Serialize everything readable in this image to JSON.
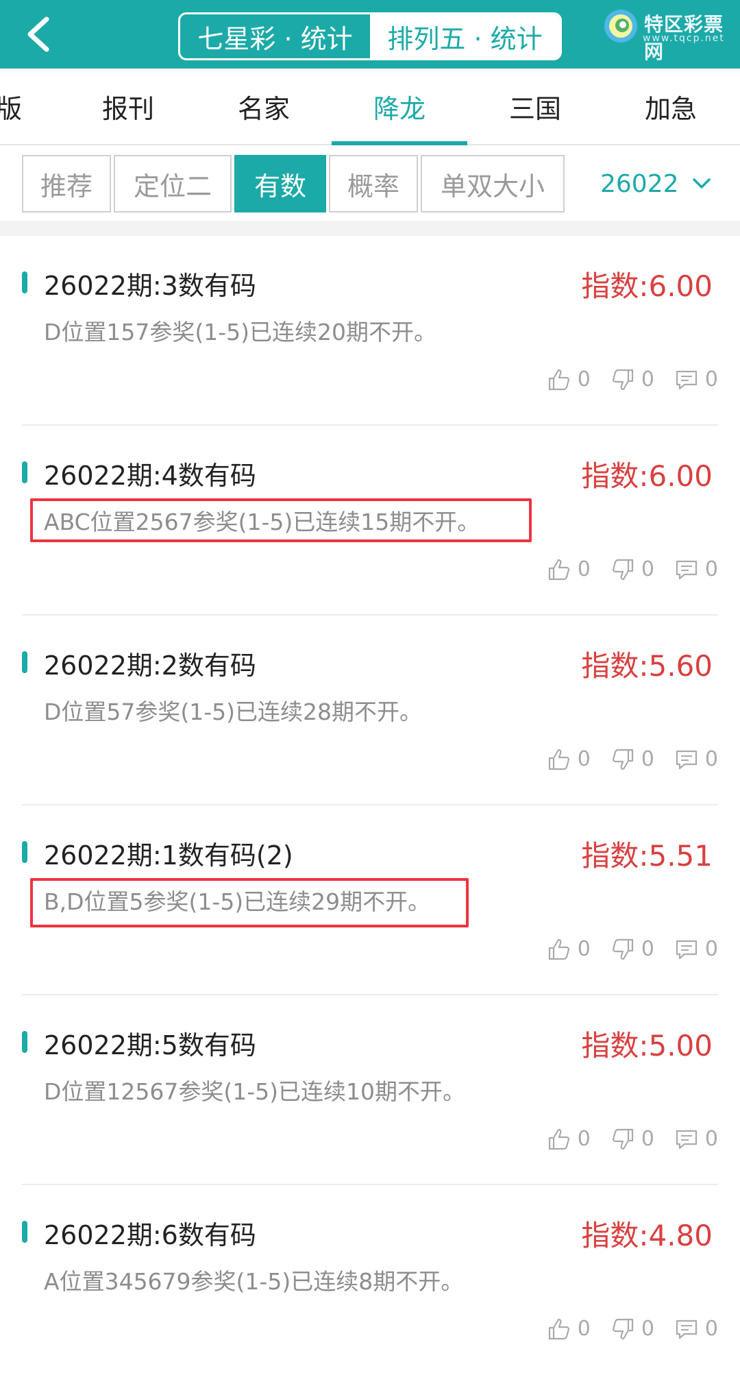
{
  "header": {
    "segments": [
      {
        "label": "七星彩 · 统计",
        "active": false
      },
      {
        "label": "排列五 · 统计",
        "active": true
      }
    ],
    "logo": {
      "text": "特区彩票网",
      "sub": "www.tqcp.net"
    }
  },
  "tabs": [
    {
      "label": "版",
      "active": false
    },
    {
      "label": "报刊",
      "active": false
    },
    {
      "label": "名家",
      "active": false
    },
    {
      "label": "降龙",
      "active": true
    },
    {
      "label": "三国",
      "active": false
    },
    {
      "label": "加急",
      "active": false
    }
  ],
  "filters": [
    {
      "label": "推荐",
      "active": false
    },
    {
      "label": "定位二",
      "active": false
    },
    {
      "label": "有数",
      "active": true
    },
    {
      "label": "概率",
      "active": false
    },
    {
      "label": "单双大小",
      "active": false
    }
  ],
  "period": "26022",
  "colors": {
    "accent": "#1caaa8",
    "score": "#d94040",
    "highlight": "#ef3340"
  },
  "items": [
    {
      "title": "26022期:3数有码",
      "score": "指数:6.00",
      "desc": "D位置157参奖(1-5)已连续20期不开。",
      "likes": "0",
      "dislikes": "0",
      "comments": "0",
      "highlighted": false
    },
    {
      "title": "26022期:4数有码",
      "score": "指数:6.00",
      "desc": "ABC位置2567参奖(1-5)已连续15期不开。",
      "likes": "0",
      "dislikes": "0",
      "comments": "0",
      "highlighted": true
    },
    {
      "title": "26022期:2数有码",
      "score": "指数:5.60",
      "desc": "D位置57参奖(1-5)已连续28期不开。",
      "likes": "0",
      "dislikes": "0",
      "comments": "0",
      "highlighted": false
    },
    {
      "title": "26022期:1数有码(2)",
      "score": "指数:5.51",
      "desc": "B,D位置5参奖(1-5)已连续29期不开。",
      "likes": "0",
      "dislikes": "0",
      "comments": "0",
      "highlighted": true
    },
    {
      "title": "26022期:5数有码",
      "score": "指数:5.00",
      "desc": "D位置12567参奖(1-5)已连续10期不开。",
      "likes": "0",
      "dislikes": "0",
      "comments": "0",
      "highlighted": false
    },
    {
      "title": "26022期:6数有码",
      "score": "指数:4.80",
      "desc": "A位置345679参奖(1-5)已连续8期不开。",
      "likes": "0",
      "dislikes": "0",
      "comments": "0",
      "highlighted": false
    }
  ]
}
